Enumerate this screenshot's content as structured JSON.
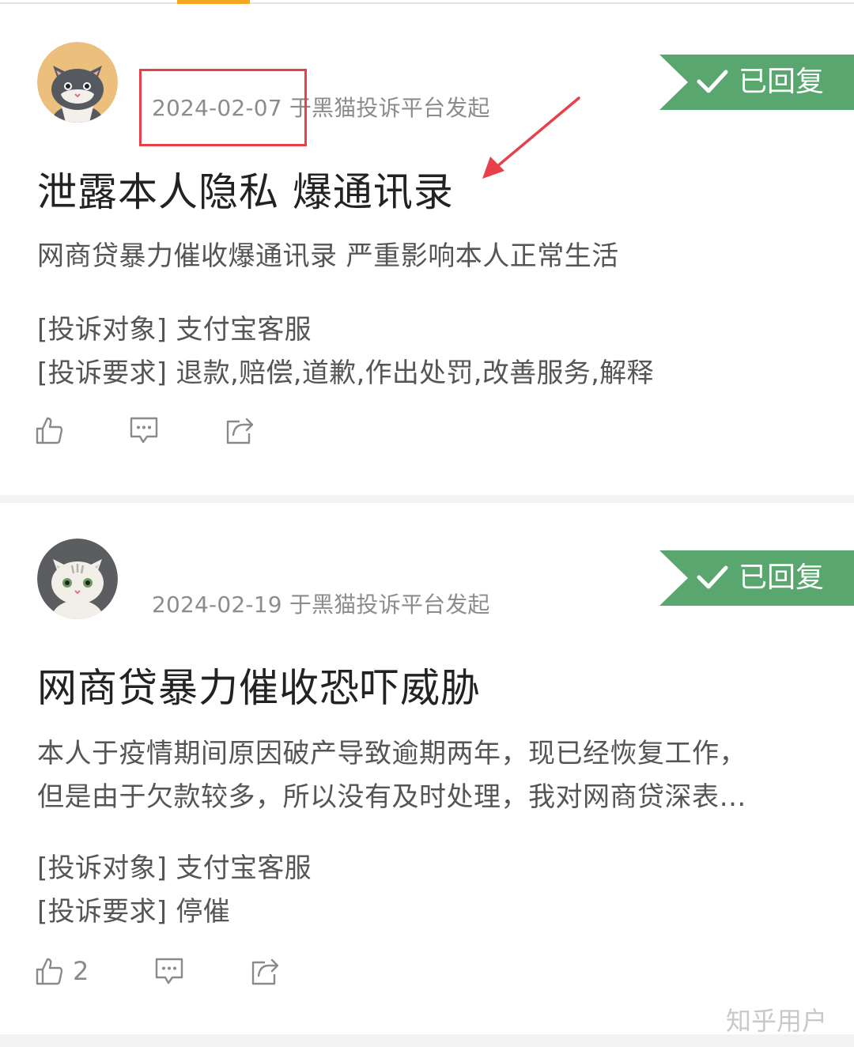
{
  "colors": {
    "badge_green": "#5aa66f",
    "tab_accent": "#f5a623",
    "annotation_red": "#e8404a",
    "meta_gray": "#8c8c8c"
  },
  "complaints": [
    {
      "avatar_icon": "cat-avatar-gray",
      "meta": "2024-02-07 于黑猫投诉平台发起",
      "badge": "已回复",
      "title": "泄露本人隐私 爆通讯录",
      "description_lines": [
        "网商贷暴力催收爆通讯录 严重影响本人正常生活"
      ],
      "target": "[投诉对象] 支付宝客服",
      "request": "[投诉要求] 退款,赔偿,道歉,作出处罚,改善服务,解释",
      "likes": ""
    },
    {
      "avatar_icon": "cat-avatar-white",
      "meta": "2024-02-19 于黑猫投诉平台发起",
      "badge": "已回复",
      "title": "网商贷暴力催收恐吓威胁",
      "description_lines": [
        "本人于疫情期间原因破产导致逾期两年，现已经恢复工作，",
        "但是由于欠款较多，所以没有及时处理，我对网商贷深表…"
      ],
      "target": "[投诉对象] 支付宝客服",
      "request": "[投诉要求] 停催",
      "likes": "2"
    }
  ],
  "watermark": "知乎用户"
}
